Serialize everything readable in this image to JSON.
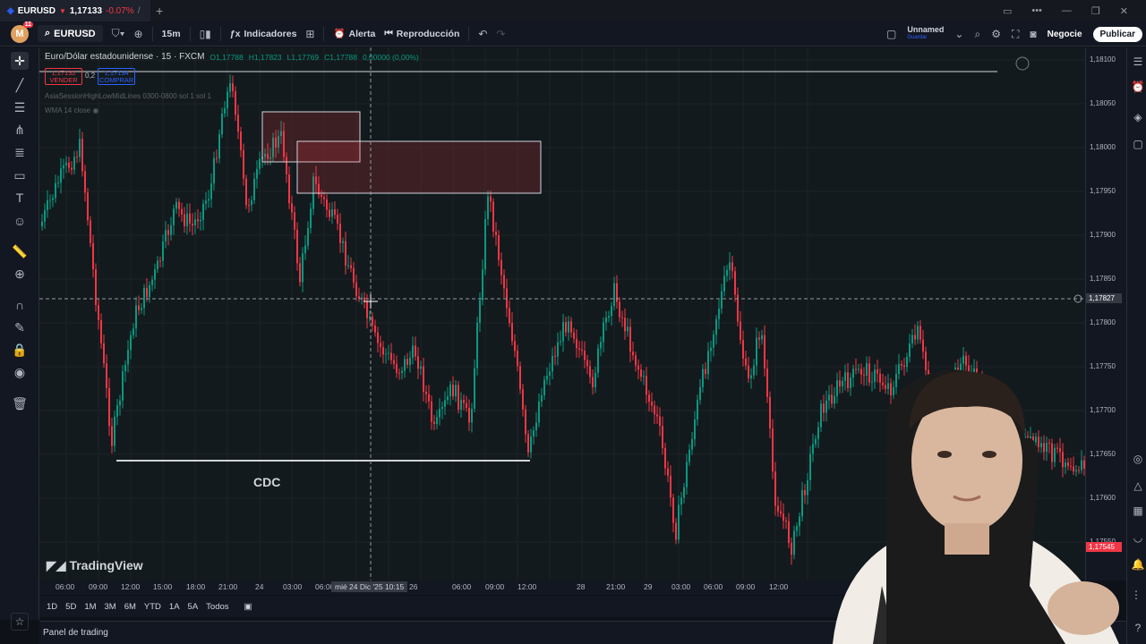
{
  "browser": {
    "tab_symbol": "EURUSD",
    "tab_price": "1,17133",
    "tab_change": "-0.07%",
    "tab_rest": "/ Un"
  },
  "toolbar": {
    "avatar_letter": "M",
    "notifications": "11",
    "symbol": "EURUSD",
    "interval": "15m",
    "indicators_label": "Indicadores",
    "alert_label": "Alerta",
    "replay_label": "Reproducción",
    "layout_name": "Unnamed",
    "layout_sub": "Guardar",
    "trade_label": "Negocie",
    "publish_label": "Publicar"
  },
  "legend": {
    "title": "Euro/Dólar estadounidense · 15 · FXCM",
    "open": "O1,17788",
    "high": "H1,17823",
    "low": "L1,17769",
    "close": "C1,17788",
    "change": "0,00000 (0,00%)",
    "sell_price": "1,17132",
    "sell_label": "VENDER",
    "spread": "0,2",
    "buy_price": "1,17134",
    "buy_label": "COMPRAR",
    "indicator1": "AsiaSessionHighLowMidLines 0300-0800 sol 1 sol 1",
    "indicator2": "WMA 14 close"
  },
  "annotation": {
    "label": "CDC"
  },
  "watermark": "TradingView",
  "price_axis": {
    "labels": [
      "1,18100",
      "1,18050",
      "1,18000",
      "1,17950",
      "1,17900",
      "1,17850",
      "1,17800",
      "1,17750",
      "1,17700",
      "1,17650",
      "1,17600",
      "1,17550"
    ],
    "crosshair_price": "1,17827",
    "last_price": "1,17545"
  },
  "time_axis": {
    "labels": [
      "06:00",
      "09:00",
      "12:00",
      "15:00",
      "18:00",
      "21:00",
      "24",
      "03:00",
      "06:00",
      "26",
      "06:00",
      "09:00",
      "12:00",
      "28",
      "21:00",
      "29",
      "03:00",
      "06:00",
      "09:00",
      "12:00"
    ],
    "crosshair_time": "mié 24 Dic '25",
    "crosshair_clock": "10:15"
  },
  "ranges": [
    "1D",
    "5D",
    "1M",
    "3M",
    "6M",
    "YTD",
    "1A",
    "5A",
    "Todos"
  ],
  "bottom_panel": {
    "label": "Panel de trading"
  },
  "colors": {
    "up": "#089981",
    "down": "#f23645",
    "accent": "#2962ff",
    "background": "#131a1d"
  }
}
